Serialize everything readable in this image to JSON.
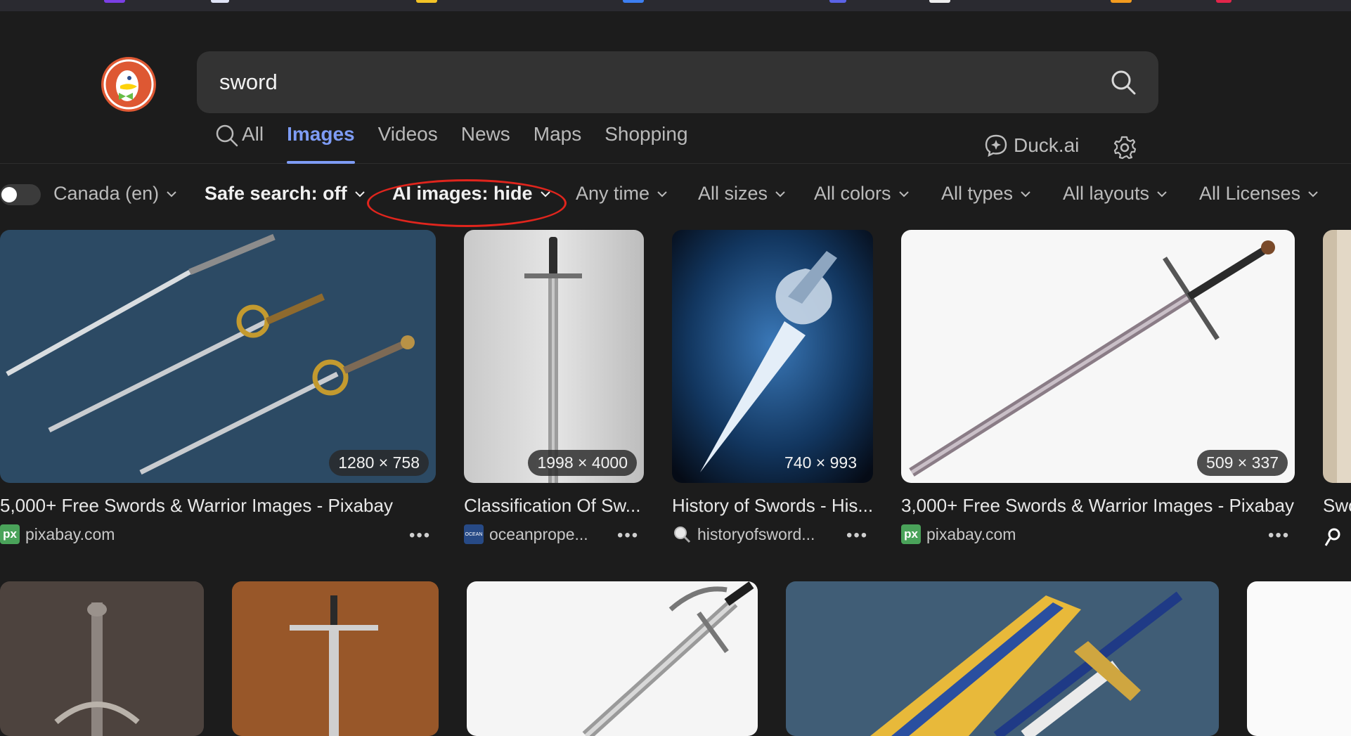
{
  "search": {
    "query": "sword"
  },
  "tabs": [
    {
      "label": "All",
      "icon": "search-icon"
    },
    {
      "label": "Images"
    },
    {
      "label": "Videos"
    },
    {
      "label": "News"
    },
    {
      "label": "Maps"
    },
    {
      "label": "Shopping"
    }
  ],
  "active_tab": "Images",
  "duckai": {
    "label": "Duck.ai",
    "icon": "duckai-icon"
  },
  "filters": {
    "region": "Canada (en)",
    "safe_search": "Safe search: off",
    "ai_images": "AI images: hide",
    "time": "Any time",
    "size": "All sizes",
    "color": "All colors",
    "type": "All types",
    "layout": "All layouts",
    "license": "All Licenses"
  },
  "results": [
    {
      "dimensions": "1280 × 758",
      "title": "5,000+ Free Swords & Warrior Images - Pixabay",
      "source": "pixabay.com",
      "favicon_text": "px"
    },
    {
      "dimensions": "1998 × 4000",
      "title": "Classification Of Sw...",
      "source": "oceanprope...",
      "favicon_text": "OCEAN"
    },
    {
      "dimensions": "740 × 993",
      "title": "History of Swords - His...",
      "source": "historyofsword...",
      "favicon_text": ""
    },
    {
      "dimensions": "509 × 337",
      "title": "3,000+ Free Swords & Warrior Images - Pixabay",
      "source": "pixabay.com",
      "favicon_text": "px"
    },
    {
      "title": "Swo"
    }
  ],
  "more_label": "•••",
  "colors": {
    "background": "#1c1c1c",
    "accent": "#7e9cf5",
    "annotation": "#e0251d",
    "search_bg": "#333333"
  }
}
